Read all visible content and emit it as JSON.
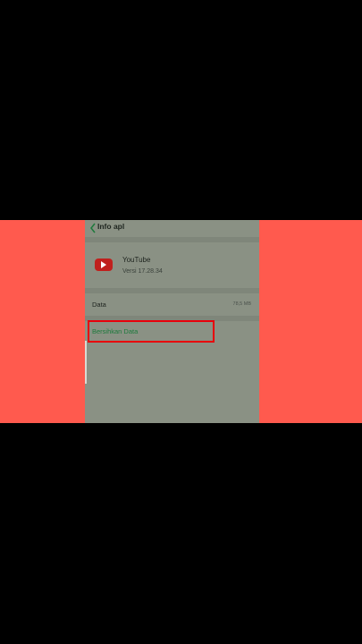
{
  "header": {
    "title": "Info apl",
    "back_icon": "chevron-left-icon"
  },
  "app": {
    "name": "YouTube",
    "version": "Versi  17.28.34",
    "icon": "youtube-icon"
  },
  "storage": {
    "data_label": "Data",
    "data_size": "78,5 MB",
    "clear_data_label": "Bersihkan Data"
  },
  "colors": {
    "side_panels": "#ff5a4e",
    "screen": "#8a9184",
    "accent_green": "#1d7a3c",
    "highlight": "#e8000b"
  }
}
